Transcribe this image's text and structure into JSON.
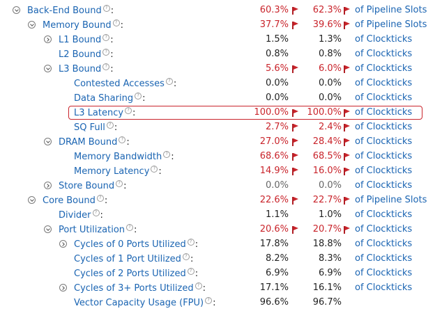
{
  "metrics": [
    {
      "name": "Back-End Bound",
      "depth": 0,
      "toggle": "expanded",
      "v1": "60.3%",
      "v2": "62.3%",
      "flag1": true,
      "flag2": true,
      "unit": "of Pipeline Slots",
      "highlight": false
    },
    {
      "name": "Memory Bound",
      "depth": 1,
      "toggle": "expanded",
      "v1": "37.7%",
      "v2": "39.6%",
      "flag1": true,
      "flag2": true,
      "unit": "of Pipeline Slots",
      "highlight": false
    },
    {
      "name": "L1 Bound",
      "depth": 2,
      "toggle": "collapsed",
      "v1": "1.5%",
      "v2": "1.3%",
      "flag1": false,
      "flag2": false,
      "unit": "of Clockticks",
      "highlight": false
    },
    {
      "name": "L2 Bound",
      "depth": 2,
      "toggle": "none",
      "v1": "0.8%",
      "v2": "0.8%",
      "flag1": false,
      "flag2": false,
      "unit": "of Clockticks",
      "highlight": false
    },
    {
      "name": "L3 Bound",
      "depth": 2,
      "toggle": "expanded",
      "v1": "5.6%",
      "v2": "6.0%",
      "flag1": true,
      "flag2": true,
      "unit": "of Clockticks",
      "highlight": false
    },
    {
      "name": "Contested Accesses",
      "depth": 3,
      "toggle": "none",
      "v1": "0.0%",
      "v2": "0.0%",
      "flag1": false,
      "flag2": false,
      "unit": "of Clockticks",
      "highlight": false
    },
    {
      "name": "Data Sharing",
      "depth": 3,
      "toggle": "none",
      "v1": "0.0%",
      "v2": "0.0%",
      "flag1": false,
      "flag2": false,
      "unit": "of Clockticks",
      "highlight": false
    },
    {
      "name": "L3 Latency",
      "depth": 3,
      "toggle": "none",
      "v1": "100.0%",
      "v2": "100.0%",
      "flag1": true,
      "flag2": true,
      "unit": "of Clockticks",
      "highlight": true
    },
    {
      "name": "SQ Full",
      "depth": 3,
      "toggle": "none",
      "v1": "2.7%",
      "v2": "2.4%",
      "flag1": true,
      "flag2": true,
      "unit": "of Clockticks",
      "highlight": false
    },
    {
      "name": "DRAM Bound",
      "depth": 2,
      "toggle": "expanded",
      "v1": "27.0%",
      "v2": "28.4%",
      "flag1": true,
      "flag2": true,
      "unit": "of Clockticks",
      "highlight": false
    },
    {
      "name": "Memory Bandwidth",
      "depth": 3,
      "toggle": "none",
      "v1": "68.6%",
      "v2": "68.5%",
      "flag1": true,
      "flag2": true,
      "unit": "of Clockticks",
      "highlight": false
    },
    {
      "name": "Memory Latency",
      "depth": 3,
      "toggle": "none",
      "v1": "14.9%",
      "v2": "16.0%",
      "flag1": true,
      "flag2": true,
      "unit": "of Clockticks",
      "highlight": false
    },
    {
      "name": "Store Bound",
      "depth": 2,
      "toggle": "collapsed",
      "v1": "0.0%",
      "v2": "0.0%",
      "flag1": false,
      "flag2": false,
      "unit": "of Clockticks",
      "highlight": false,
      "grey": true
    },
    {
      "name": "Core Bound",
      "depth": 1,
      "toggle": "expanded",
      "v1": "22.6%",
      "v2": "22.7%",
      "flag1": true,
      "flag2": true,
      "unit": "of Pipeline Slots",
      "highlight": false
    },
    {
      "name": "Divider",
      "depth": 2,
      "toggle": "none",
      "v1": "1.1%",
      "v2": "1.0%",
      "flag1": false,
      "flag2": false,
      "unit": "of Clockticks",
      "highlight": false
    },
    {
      "name": "Port Utilization",
      "depth": 2,
      "toggle": "expanded",
      "v1": "20.6%",
      "v2": "20.7%",
      "flag1": true,
      "flag2": true,
      "unit": "of Clockticks",
      "highlight": false
    },
    {
      "name": "Cycles of 0 Ports Utilized",
      "depth": 3,
      "toggle": "collapsed",
      "v1": "17.8%",
      "v2": "18.8%",
      "flag1": false,
      "flag2": false,
      "unit": "of Clockticks",
      "highlight": false
    },
    {
      "name": "Cycles of 1 Port Utilized",
      "depth": 3,
      "toggle": "none",
      "v1": "8.2%",
      "v2": "8.3%",
      "flag1": false,
      "flag2": false,
      "unit": "of Clockticks",
      "highlight": false
    },
    {
      "name": "Cycles of 2 Ports Utilized",
      "depth": 3,
      "toggle": "none",
      "v1": "6.9%",
      "v2": "6.9%",
      "flag1": false,
      "flag2": false,
      "unit": "of Clockticks",
      "highlight": false
    },
    {
      "name": "Cycles of 3+ Ports Utilized",
      "depth": 3,
      "toggle": "collapsed",
      "v1": "17.1%",
      "v2": "16.1%",
      "flag1": false,
      "flag2": false,
      "unit": "of Clockticks",
      "highlight": false
    },
    {
      "name": "Vector Capacity Usage (FPU)",
      "depth": 3,
      "toggle": "none",
      "v1": "96.6%",
      "v2": "96.7%",
      "flag1": false,
      "flag2": false,
      "unit": "",
      "highlight": false
    }
  ],
  "help_glyph": "?",
  "colon": ":",
  "colors": {
    "link": "#1a64b2",
    "alert": "#c9242b",
    "text": "#222222",
    "muted": "#666666"
  },
  "icons": {
    "toggle_expanded": "chevron-down-icon",
    "toggle_collapsed": "chevron-right-icon",
    "help": "help-icon",
    "flag": "flag-icon"
  }
}
